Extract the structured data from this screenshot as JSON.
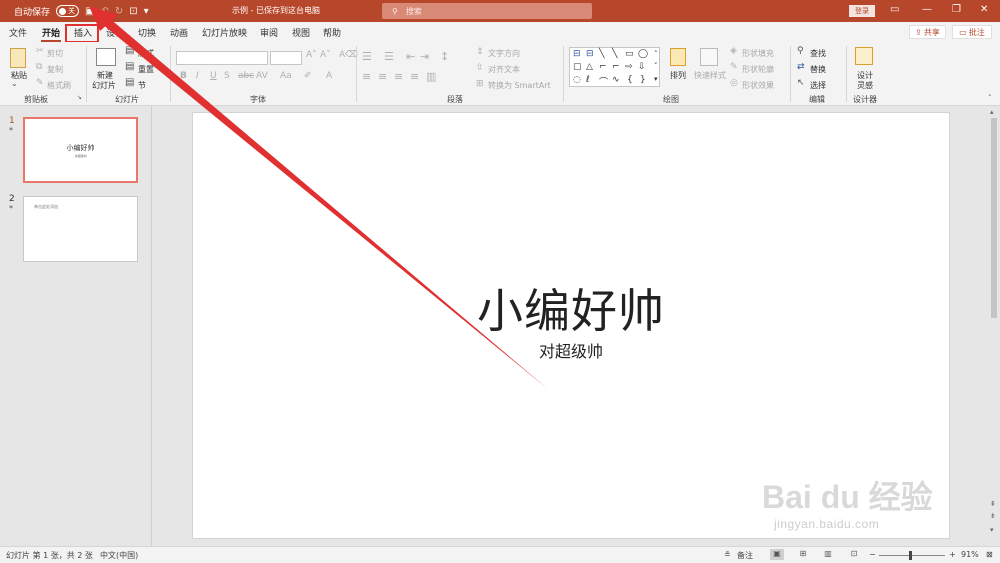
{
  "titlebar": {
    "autosave_label": "自动保存",
    "autosave_state": "关",
    "doc_title": "示例 - 已保存到这台电脑",
    "search_placeholder": "搜索",
    "login_label": "登录",
    "save_icon": "save-icon",
    "undo_icon": "undo-icon",
    "redo_icon": "redo-icon"
  },
  "tabs": [
    "文件",
    "开始",
    "插入",
    "设计",
    "切换",
    "动画",
    "幻灯片放映",
    "审阅",
    "视图",
    "帮助"
  ],
  "active_tab": "开始",
  "share_label": "共享",
  "comment_label": "批注",
  "ribbon": {
    "clipboard": {
      "label": "剪贴板",
      "paste": "粘贴",
      "cut": "剪切",
      "copy": "复制",
      "format_painter": "格式刷"
    },
    "slides": {
      "label": "幻灯片",
      "new_slide_1": "新建",
      "new_slide_2": "幻灯片",
      "layout": "版式",
      "reset": "重置",
      "section": "节"
    },
    "font": {
      "label": "字体"
    },
    "paragraph": {
      "label": "段落",
      "text_direction": "文字方向",
      "align_text": "对齐文本",
      "smartart": "转换为 SmartArt"
    },
    "drawing": {
      "label": "绘图",
      "arrange": "排列",
      "quick_styles": "快速样式",
      "shape_fill": "形状填充",
      "shape_outline": "形状轮廓",
      "shape_effects": "形状效果"
    },
    "editing": {
      "label": "编辑",
      "find": "查找",
      "replace": "替换",
      "select": "选择"
    },
    "designer": {
      "label": "设计器",
      "design_ideas_1": "设计",
      "design_ideas_2": "灵感"
    }
  },
  "thumbnails": [
    {
      "number": "1",
      "title": "小编好帅",
      "subtitle": "对超级帅"
    },
    {
      "number": "2",
      "text": "单击此处添加"
    }
  ],
  "slide": {
    "title": "小编好帅",
    "subtitle": "对超级帅"
  },
  "watermark": {
    "brand": "Bai du 经验",
    "url": "jingyan.baidu.com"
  },
  "statusbar": {
    "slide_info": "幻灯片 第 1 张，共 2 张",
    "language": "中文(中国)",
    "notes": "备注",
    "zoom": "91%"
  },
  "colors": {
    "accent": "#b7472a",
    "highlight": "#e03030"
  }
}
